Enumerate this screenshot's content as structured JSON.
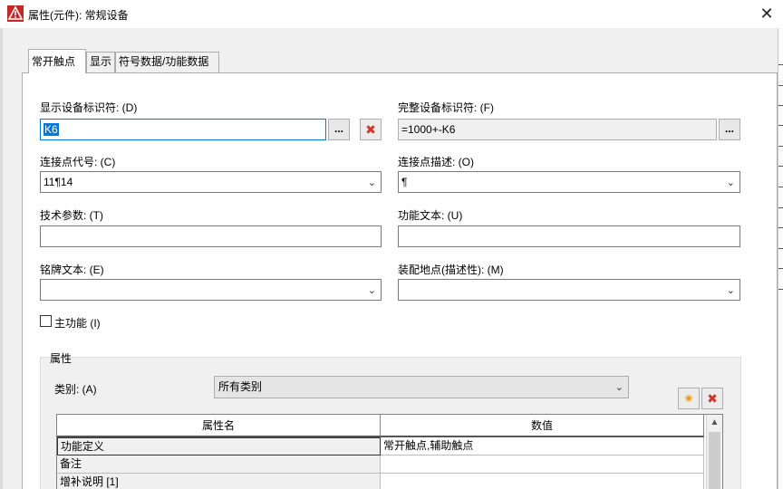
{
  "window": {
    "title": "属性(元件): 常规设备",
    "close_glyph": "✕"
  },
  "tabs": [
    {
      "label": "常开触点"
    },
    {
      "label": "显示"
    },
    {
      "label": "符号数据/功能数据"
    }
  ],
  "form": {
    "display_id_label": "显示设备标识符: (D)",
    "display_id_value": "K6",
    "full_id_label": "完整设备标识符: (F)",
    "full_id_value": "=1000+-K6",
    "conn_code_label": "连接点代号: (C)",
    "conn_code_value": "11¶14",
    "conn_desc_label": "连接点描述: (O)",
    "conn_desc_value": "¶",
    "tech_param_label": "技术参数: (T)",
    "tech_param_value": "",
    "func_text_label": "功能文本: (U)",
    "func_text_value": "",
    "nameplate_label": "铭牌文本: (E)",
    "nameplate_value": "",
    "mount_label": "装配地点(描述性): (M)",
    "mount_value": "",
    "main_function_label": "主功能 (I)",
    "main_function_checked": false,
    "browse_glyph": "...",
    "delete_glyph": "✖"
  },
  "properties": {
    "group_title": "属性",
    "category_label": "类别: (A)",
    "category_value": "所有类别",
    "new_glyph": "✷",
    "delete_glyph": "✖",
    "columns": [
      "属性名",
      "数值"
    ],
    "rows": [
      {
        "name": "功能定义",
        "value": "常开触点,辅助触点"
      },
      {
        "name": "备注",
        "value": ""
      },
      {
        "name": "增补说明 [1]",
        "value": ""
      }
    ]
  },
  "icons": {
    "app": "warning-triangle-icon",
    "close": "close-icon",
    "dropdown": "chevron-down-icon",
    "scroll_up": "scroll-up-arrow-icon"
  },
  "colors": {
    "app_icon": "#c62828",
    "focus_border": "#0078d7",
    "selection": "#0078d7",
    "delete_red": "#d0362a",
    "new_orange": "#e9a21b"
  }
}
